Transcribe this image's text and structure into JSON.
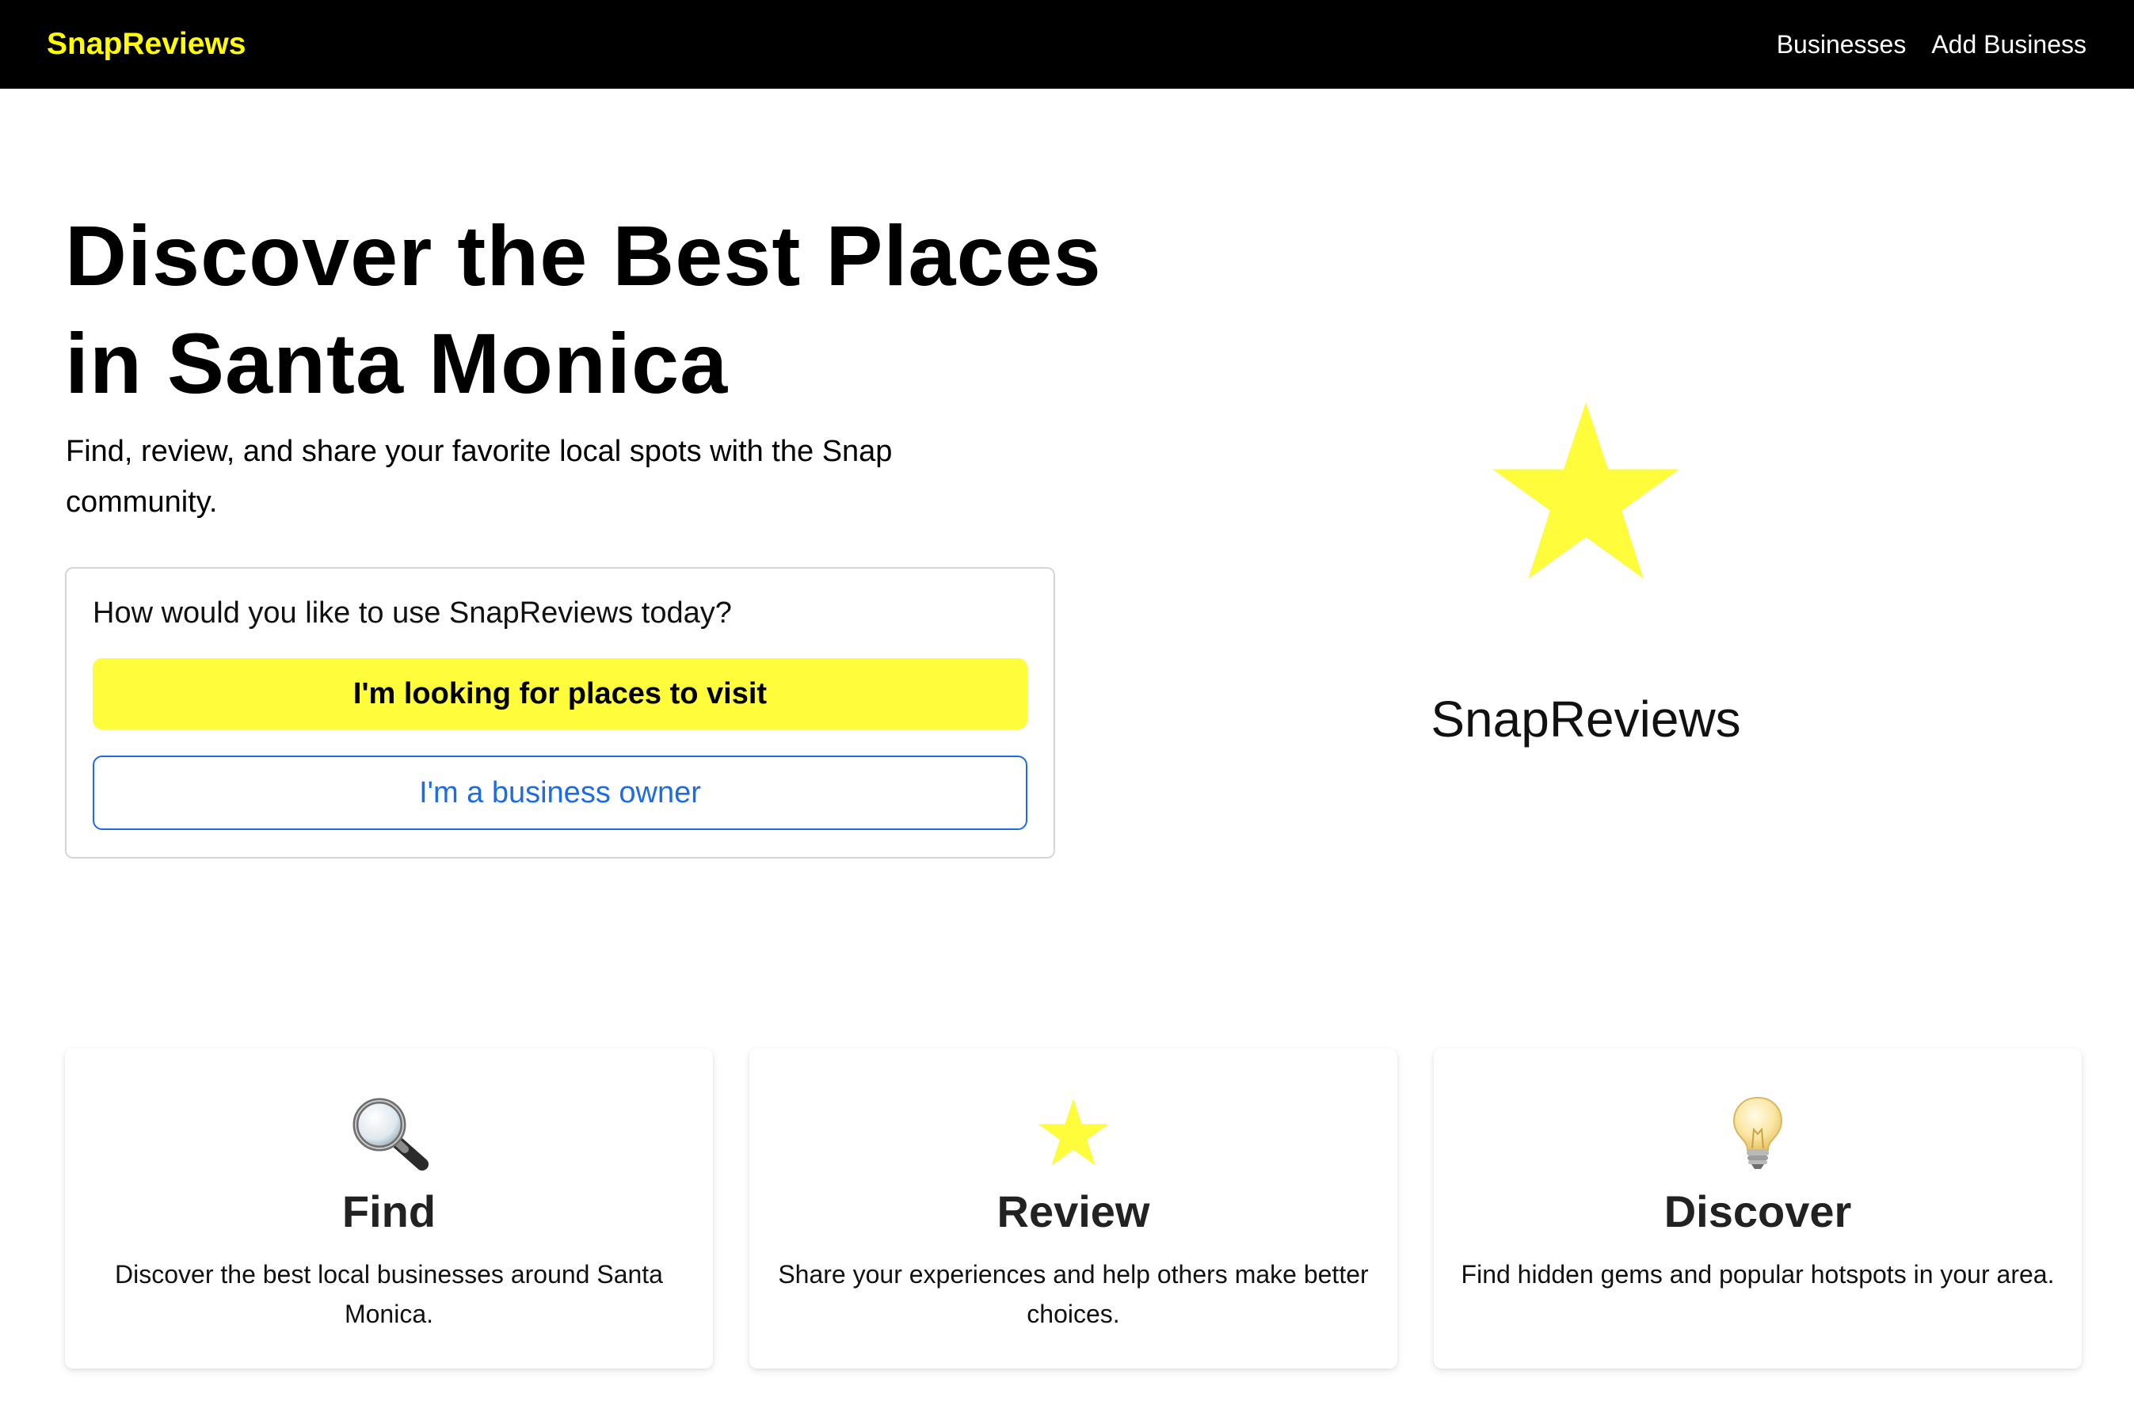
{
  "navbar": {
    "brand": "SnapReviews",
    "links": [
      "Businesses",
      "Add Business"
    ]
  },
  "hero": {
    "title": "Discover the Best Places in Santa Monica",
    "subtitle": "Find, review, and share your favorite local spots with the Snap community.",
    "question": "How would you like to use SnapReviews today?",
    "primary_button": "I'm looking for places to visit",
    "secondary_button": "I'm a business owner"
  },
  "showcase": {
    "icon": "star-icon",
    "name": "SnapReviews"
  },
  "features": [
    {
      "icon": "magnifying-glass-icon",
      "title": "Find",
      "text": "Discover the best local businesses around Santa Monica."
    },
    {
      "icon": "star-icon",
      "title": "Review",
      "text": "Share your experiences and help others make better choices."
    },
    {
      "icon": "light-bulb-icon",
      "title": "Discover",
      "text": "Find hidden gems and popular hotspots in your area."
    }
  ],
  "colors": {
    "navbar_bg": "#000000",
    "brand": "#FFFC00",
    "primary_button": "#FFFC3C",
    "outline_button": "#1D6CE6",
    "star": "#FFFC3C"
  }
}
